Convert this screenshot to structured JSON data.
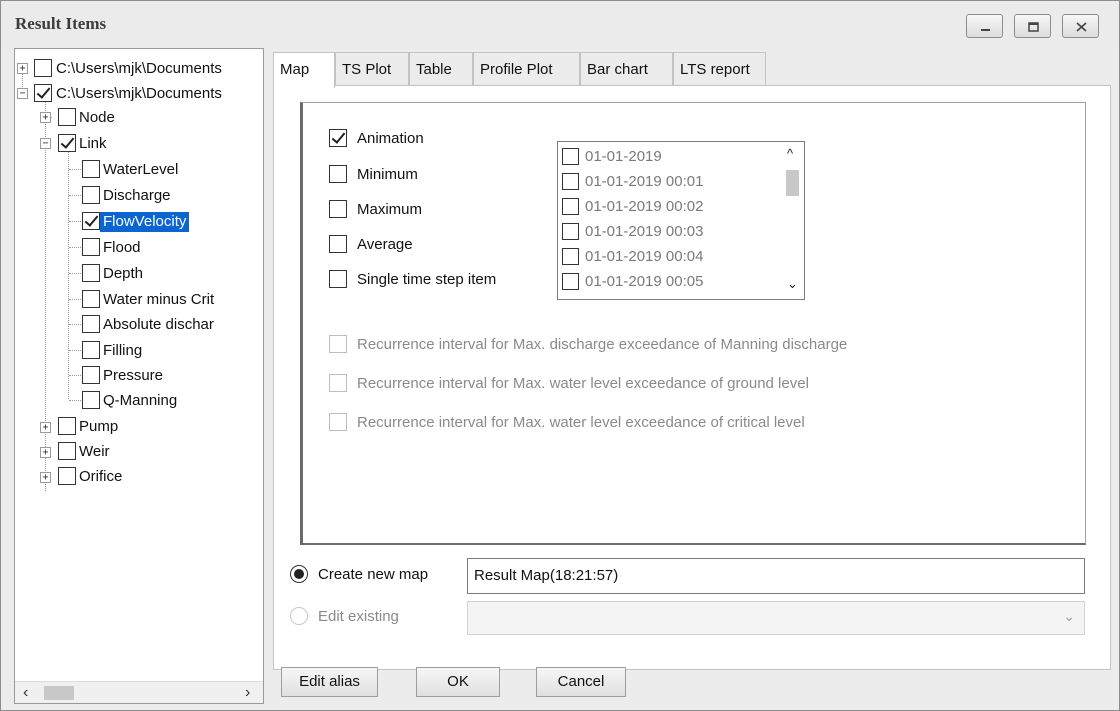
{
  "window": {
    "title": "Result Items",
    "controls": [
      "minimize-icon",
      "maximize-icon",
      "close-icon"
    ]
  },
  "tree": {
    "roots": [
      {
        "label": "C:\\Users\\mjk\\Documents",
        "checked": false,
        "expanded": false
      },
      {
        "label": "C:\\Users\\mjk\\Documents",
        "checked": true,
        "expanded": true
      }
    ],
    "groups": [
      {
        "label": "Node",
        "checked": false,
        "expanded": false
      },
      {
        "label": "Link",
        "checked": true,
        "expanded": true
      },
      {
        "label": "Pump",
        "checked": false,
        "expanded": false
      },
      {
        "label": "Weir",
        "checked": false,
        "expanded": false
      },
      {
        "label": "Orifice",
        "checked": false,
        "expanded": false
      }
    ],
    "link_items": [
      {
        "label": "WaterLevel",
        "checked": false
      },
      {
        "label": "Discharge",
        "checked": false
      },
      {
        "label": "FlowVelocity",
        "checked": true,
        "selected": true
      },
      {
        "label": "Flood",
        "checked": false
      },
      {
        "label": "Depth",
        "checked": false
      },
      {
        "label": "Water minus Crit",
        "checked": false
      },
      {
        "label": "Absolute dischar",
        "checked": false
      },
      {
        "label": "Filling",
        "checked": false
      },
      {
        "label": "Pressure",
        "checked": false
      },
      {
        "label": "Q-Manning",
        "checked": false
      }
    ]
  },
  "tabs": [
    "Map",
    "TS Plot",
    "Table",
    "Profile Plot",
    "Bar chart",
    "LTS report"
  ],
  "active_tab": "Map",
  "map_options": [
    {
      "label": "Animation",
      "checked": true
    },
    {
      "label": "Minimum",
      "checked": false
    },
    {
      "label": "Maximum",
      "checked": false
    },
    {
      "label": "Average",
      "checked": false
    },
    {
      "label": "Single time step item",
      "checked": false
    }
  ],
  "time_steps": [
    "01-01-2019",
    "01-01-2019 00:01",
    "01-01-2019 00:02",
    "01-01-2019 00:03",
    "01-01-2019 00:04",
    "01-01-2019 00:05"
  ],
  "recurrence_options": [
    "Recurrence interval for Max. discharge exceedance of Manning discharge",
    "Recurrence interval for Max. water level exceedance of ground level",
    "Recurrence interval for Max. water level exceedance of critical level"
  ],
  "map_target": {
    "create_new_label": "Create new map",
    "create_new_value": "Result Map(18:21:57)",
    "edit_existing_label": "Edit existing",
    "edit_existing_value": ""
  },
  "buttons": {
    "edit_alias": "Edit alias",
    "ok": "OK",
    "cancel": "Cancel"
  }
}
